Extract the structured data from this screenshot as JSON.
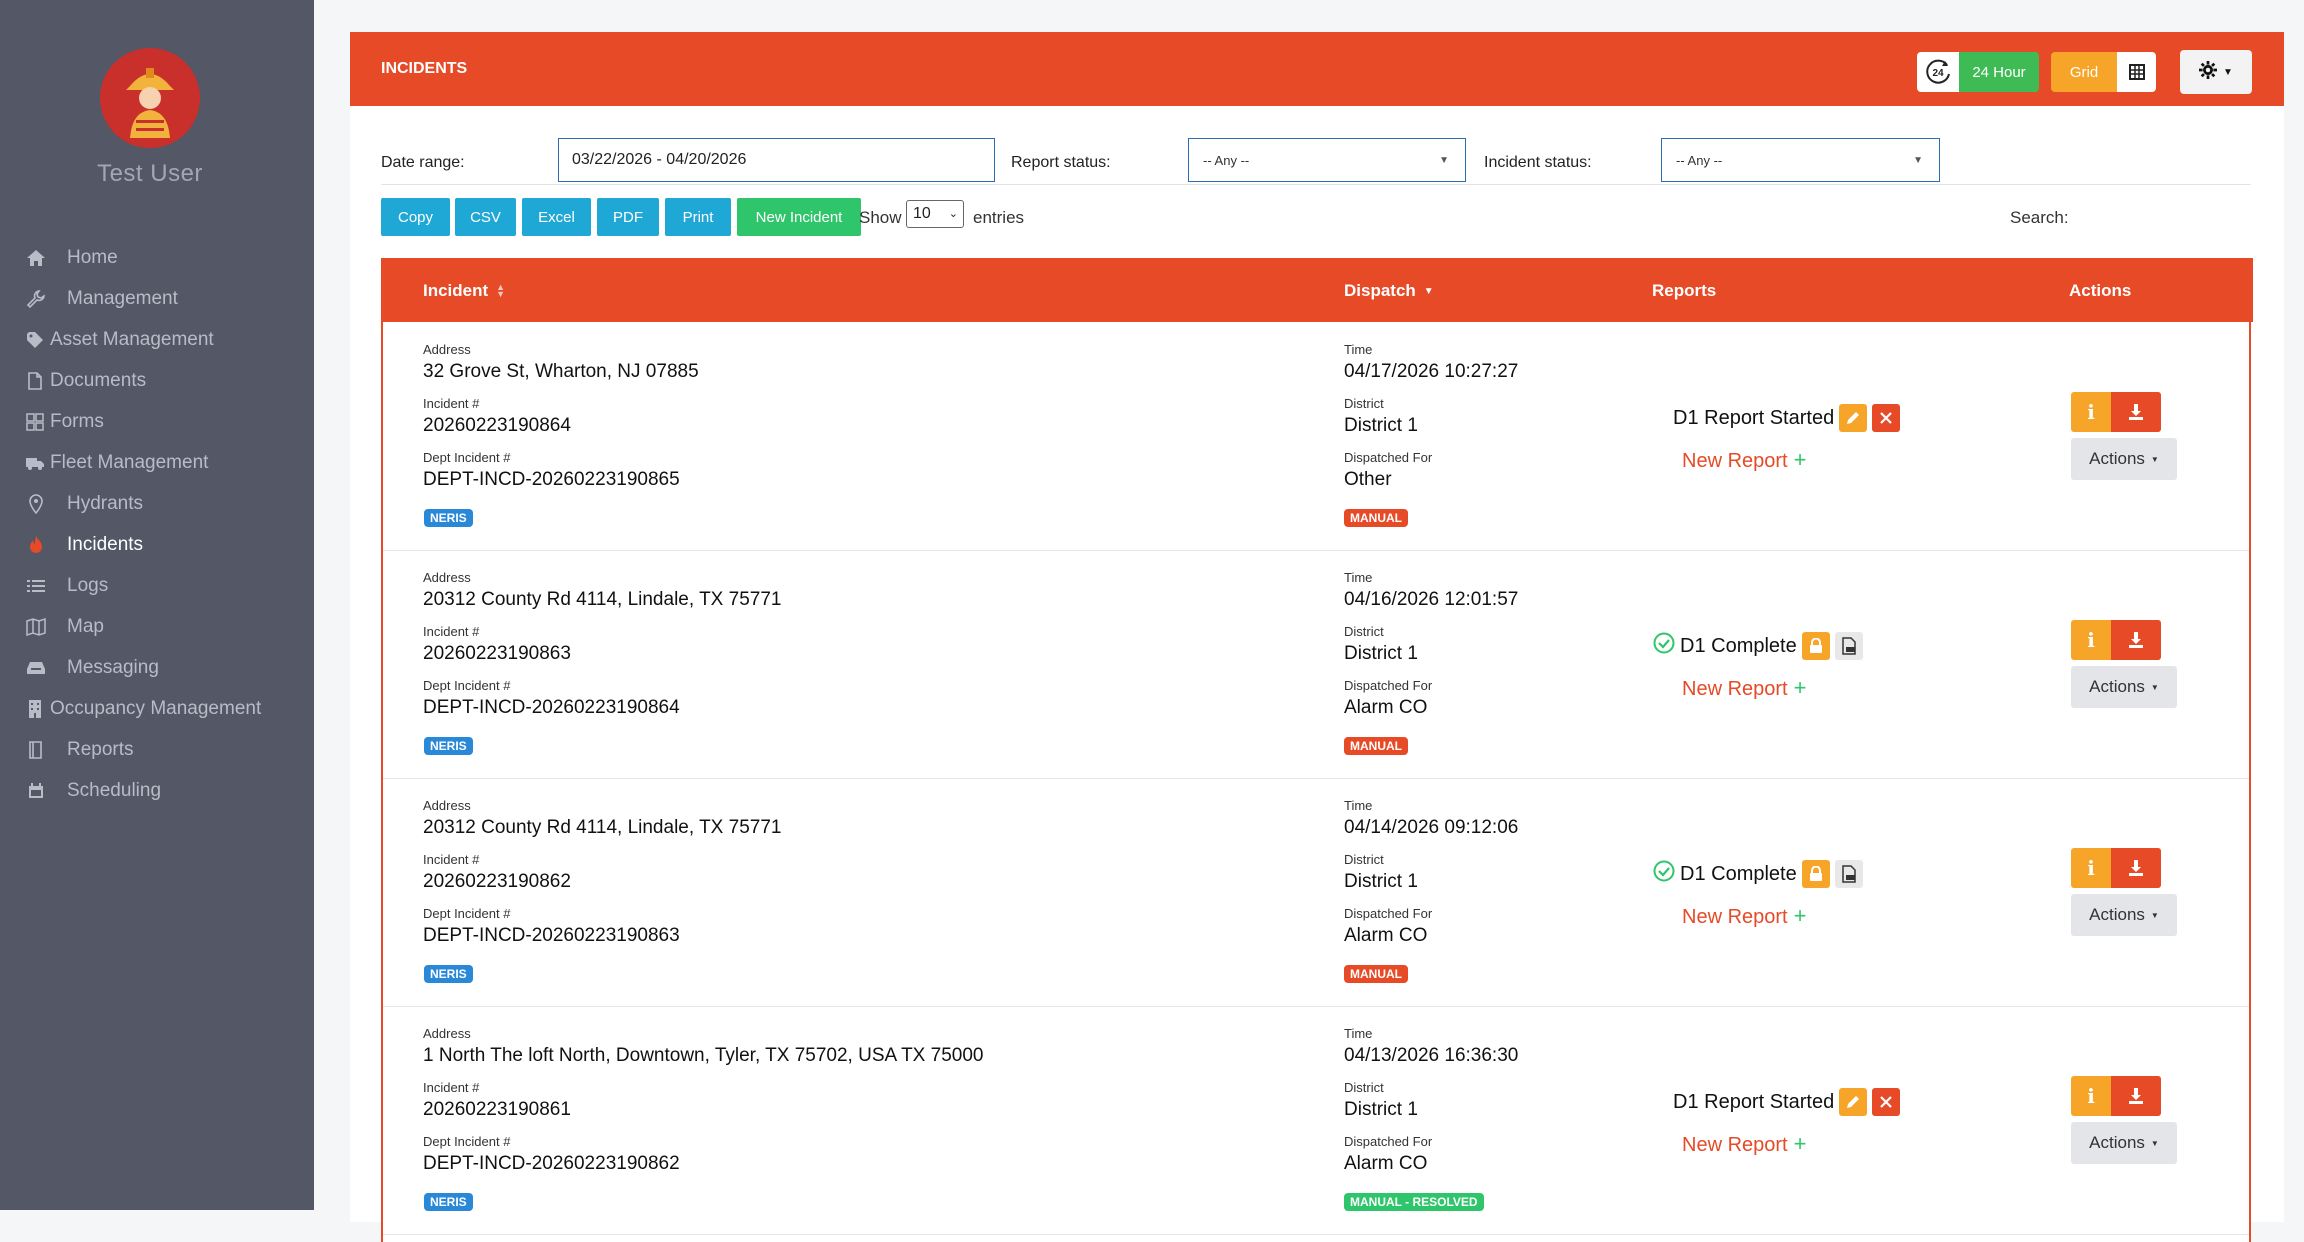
{
  "user": {
    "name": "Test User"
  },
  "nav": [
    {
      "label": "Home",
      "icon": "home-icon"
    },
    {
      "label": "Management",
      "icon": "wrench-icon"
    },
    {
      "label": "Asset Management",
      "icon": "tag-icon"
    },
    {
      "label": "Documents",
      "icon": "document-icon"
    },
    {
      "label": "Forms",
      "icon": "forms-grid-icon"
    },
    {
      "label": "Fleet Management",
      "icon": "truck-icon"
    },
    {
      "label": "Hydrants",
      "icon": "map-pin-icon"
    },
    {
      "label": "Incidents",
      "icon": "fire-icon",
      "active": true
    },
    {
      "label": "Logs",
      "icon": "list-icon"
    },
    {
      "label": "Map",
      "icon": "map-icon"
    },
    {
      "label": "Messaging",
      "icon": "inbox-icon"
    },
    {
      "label": "Occupancy Management",
      "icon": "building-icon"
    },
    {
      "label": "Reports",
      "icon": "book-icon"
    },
    {
      "label": "Scheduling",
      "icon": "calendar-icon"
    }
  ],
  "header": {
    "title": "INCIDENTS",
    "hour_toggle": "24 Hour",
    "clock_badge": "24",
    "view_toggle": "Grid"
  },
  "filters": {
    "date_label": "Date range:",
    "date_value": "03/22/2026 - 04/20/2026",
    "report_status_label": "Report status:",
    "report_status_value": "-- Any --",
    "incident_status_label": "Incident status:",
    "incident_status_value": "-- Any --"
  },
  "toolbar": {
    "copy": "Copy",
    "csv": "CSV",
    "excel": "Excel",
    "pdf": "PDF",
    "print": "Print",
    "new_incident": "New Incident",
    "show": "Show",
    "entries_value": "10",
    "entries": "entries",
    "search": "Search:"
  },
  "table": {
    "columns": {
      "incident": "Incident",
      "dispatch": "Dispatch",
      "reports": "Reports",
      "actions": "Actions"
    },
    "labels": {
      "address": "Address",
      "incident_no": "Incident #",
      "dept_incident_no": "Dept Incident #",
      "time": "Time",
      "district": "District",
      "dispatched_for": "Dispatched For",
      "new_report": "New Report",
      "actions_btn": "Actions"
    },
    "rows": [
      {
        "address": "32 Grove St, Wharton, NJ 07885",
        "incident_no": "20260223190864",
        "dept_incident_no": "DEPT-INCD-20260223190865",
        "tag": "NERIS",
        "time": "04/17/2026 10:27:27",
        "district": "District 1",
        "dispatched_for": "Other",
        "dispatch_badge": "MANUAL",
        "report_status": "D1 Report Started",
        "report_state": "started"
      },
      {
        "address": "20312 County Rd 4114, Lindale, TX 75771",
        "incident_no": "20260223190863",
        "dept_incident_no": "DEPT-INCD-20260223190864",
        "tag": "NERIS",
        "time": "04/16/2026 12:01:57",
        "district": "District 1",
        "dispatched_for": "Alarm CO",
        "dispatch_badge": "MANUAL",
        "report_status": "D1 Complete",
        "report_state": "complete"
      },
      {
        "address": "20312 County Rd 4114, Lindale, TX 75771",
        "incident_no": "20260223190862",
        "dept_incident_no": "DEPT-INCD-20260223190863",
        "tag": "NERIS",
        "time": "04/14/2026 09:12:06",
        "district": "District 1",
        "dispatched_for": "Alarm CO",
        "dispatch_badge": "MANUAL",
        "report_status": "D1 Complete",
        "report_state": "complete"
      },
      {
        "address": "1 North The loft North, Downtown, Tyler, TX 75702, USA TX 75000",
        "incident_no": "20260223190861",
        "dept_incident_no": "DEPT-INCD-20260223190862",
        "tag": "NERIS",
        "time": "04/13/2026 16:36:30",
        "district": "District 1",
        "dispatched_for": "Alarm CO",
        "dispatch_badge": "MANUAL - RESOLVED",
        "report_status": "D1 Report Started",
        "report_state": "started"
      }
    ]
  },
  "colors": {
    "sidebar": "#535766",
    "brand_orange": "#e64a26",
    "info_blue": "#1fa7d6",
    "success_green": "#2ec56b",
    "warning_yellow": "#f7a528"
  }
}
